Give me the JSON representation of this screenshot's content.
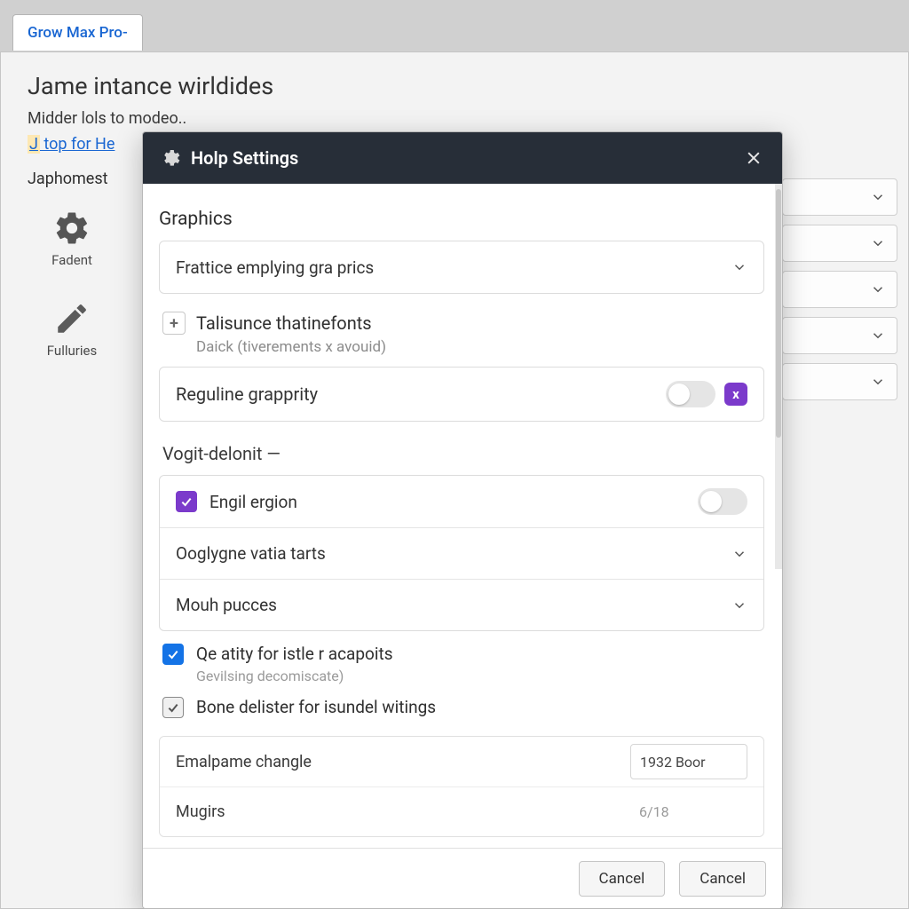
{
  "background": {
    "tab": "Grow Max Pro-",
    "heading": "Jame intance wirldides",
    "subheading": "Midder lols to modeo..",
    "link_prefix": "J",
    "link_text": " top for He",
    "side_label": "Japhomest",
    "tool_a": "Fadent",
    "tool_b": "Fulluries"
  },
  "modal": {
    "title": "Holp Settings",
    "sections": {
      "graphics": {
        "title": "Graphics",
        "dropdown_value": "Frattice emplying gra prics",
        "expander_label": "Talisunce thatinefonts",
        "expander_desc": "Daick (tiverements x avouid)",
        "toggle_a": {
          "label": "Reguline grapprity",
          "state": "off",
          "badge": "x"
        }
      },
      "vogit": {
        "title": "Vogit-delonit  —",
        "row_checkbox": {
          "label": "Engil ergion",
          "state": "checked"
        },
        "row_a": "Ooglygne vatia tarts",
        "row_b": "Mouh pucces"
      },
      "checks": {
        "a": {
          "label": "Qe atity for istle r acapoits",
          "sub": "Gevilsing decomiscate)"
        },
        "b": {
          "label": "Bone delister for isundel witings"
        }
      },
      "kv": {
        "row1": {
          "k": "Emalpame changle",
          "v": "1932 Boor"
        },
        "row2": {
          "k": "Mugirs",
          "v": "6/18"
        }
      }
    },
    "buttons": {
      "cancel1": "Cancel",
      "cancel2": "Cancel"
    }
  }
}
